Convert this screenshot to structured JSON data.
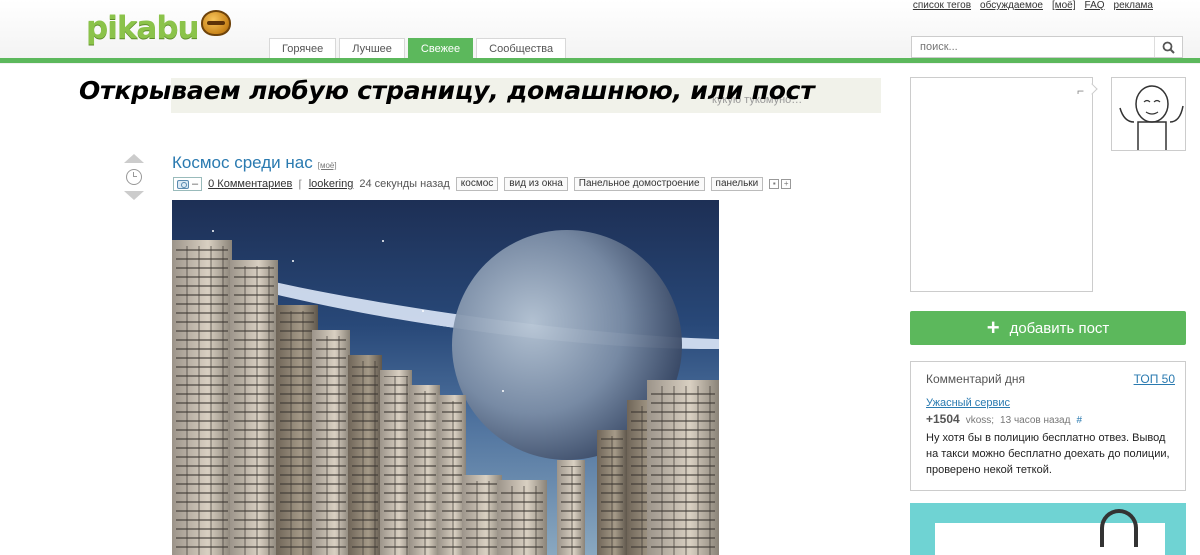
{
  "logo": {
    "text": "pikabu"
  },
  "top_links": [
    "список тегов",
    "обсуждаемое",
    "[моё]",
    "FAQ",
    "реклама"
  ],
  "tabs": [
    {
      "label": "Горячее",
      "active": false
    },
    {
      "label": "Лучшее",
      "active": false
    },
    {
      "label": "Свежее",
      "active": true
    },
    {
      "label": "Сообщества",
      "active": false
    }
  ],
  "search": {
    "placeholder": "поиск..."
  },
  "banner": {
    "text": "Открываем любую страницу, домашнюю, или пост",
    "faint_text": "кукую тукомуно…"
  },
  "post": {
    "title": "Космос среди нас",
    "mine_label": "[моё]",
    "photo_badge": "–",
    "comments": "0 Комментариев",
    "author": "lookering",
    "time": "24 секунды назад",
    "tags": [
      "космос",
      "вид из окна",
      "Панельное домостроение",
      "панельки"
    ]
  },
  "sidebar": {
    "ad_mark": "⌐",
    "add_post_label": "добавить пост",
    "comment_of_day": {
      "heading": "Комментарий дня",
      "top_link": "ТОП 50",
      "post_link": "Ужасный сервис",
      "score": "+1504",
      "user": "vkoss;",
      "time": "13 часов назад",
      "hash": "#",
      "text": "Ну хотя бы в полицию бесплатно отвез. Вывод на такси можно бесплатно доехать до полиции, проверено некой теткой."
    }
  },
  "colors": {
    "accent_green": "#5cb85c",
    "link_blue": "#2a7ab0"
  }
}
